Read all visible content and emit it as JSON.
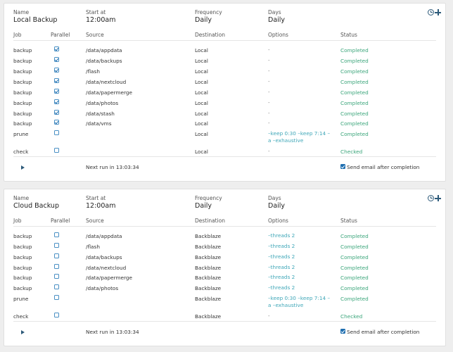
{
  "labels": {
    "name": "Name",
    "start_at": "Start at",
    "frequency": "Frequency",
    "days": "Days",
    "col_job": "Job",
    "col_parallel": "Parallel",
    "col_source": "Source",
    "col_destination": "Destination",
    "col_options": "Options",
    "col_status": "Status",
    "email": "Send email after completion"
  },
  "icons": {
    "schedule": "clock-icon",
    "add": "plus-icon",
    "run": "play-icon",
    "checkbox": "checkbox-icon"
  },
  "colors": {
    "status_green": "#3aa57a",
    "option_teal": "#3fa7b8",
    "icon_navy": "#2e5b7a",
    "checkbox_blue": "#1f6fb0"
  },
  "cards": [
    {
      "name": "Local Backup",
      "start_at": "12:00am",
      "frequency": "Daily",
      "days": "Daily",
      "next_run": "Next run in 13:03:34",
      "email_checked": true,
      "rows": [
        {
          "job": "backup",
          "parallel": true,
          "source": "/data/appdata",
          "destination": "Local",
          "options": "-",
          "status": "Completed"
        },
        {
          "job": "backup",
          "parallel": true,
          "source": "/data/backups",
          "destination": "Local",
          "options": "-",
          "status": "Completed"
        },
        {
          "job": "backup",
          "parallel": true,
          "source": "/flash",
          "destination": "Local",
          "options": "-",
          "status": "Completed"
        },
        {
          "job": "backup",
          "parallel": true,
          "source": "/data/nextcloud",
          "destination": "Local",
          "options": "-",
          "status": "Completed"
        },
        {
          "job": "backup",
          "parallel": true,
          "source": "/data/papermerge",
          "destination": "Local",
          "options": "-",
          "status": "Completed"
        },
        {
          "job": "backup",
          "parallel": true,
          "source": "/data/photos",
          "destination": "Local",
          "options": "-",
          "status": "Completed"
        },
        {
          "job": "backup",
          "parallel": true,
          "source": "/data/stash",
          "destination": "Local",
          "options": "-",
          "status": "Completed"
        },
        {
          "job": "backup",
          "parallel": true,
          "source": "/data/vms",
          "destination": "Local",
          "options": "-",
          "status": "Completed"
        },
        {
          "job": "prune",
          "parallel": false,
          "source": "",
          "destination": "Local",
          "options": "–keep 0:30 –keep 7:14 –a –exhaustive",
          "status": "Completed"
        },
        {
          "job": "check",
          "parallel": false,
          "source": "",
          "destination": "Local",
          "options": "-",
          "status": "Checked"
        }
      ]
    },
    {
      "name": "Cloud Backup",
      "start_at": "12:00am",
      "frequency": "Daily",
      "days": "Daily",
      "next_run": "Next run in 13:03:34",
      "email_checked": true,
      "rows": [
        {
          "job": "backup",
          "parallel": false,
          "source": "/data/appdata",
          "destination": "Backblaze",
          "options": "–threads 2",
          "status": "Completed"
        },
        {
          "job": "backup",
          "parallel": false,
          "source": "/flash",
          "destination": "Backblaze",
          "options": "–threads 2",
          "status": "Completed"
        },
        {
          "job": "backup",
          "parallel": false,
          "source": "/data/backups",
          "destination": "Backblaze",
          "options": "–threads 2",
          "status": "Completed"
        },
        {
          "job": "backup",
          "parallel": false,
          "source": "/data/nextcloud",
          "destination": "Backblaze",
          "options": "–threads 2",
          "status": "Completed"
        },
        {
          "job": "backup",
          "parallel": false,
          "source": "/data/papermerge",
          "destination": "Backblaze",
          "options": "–threads 2",
          "status": "Completed"
        },
        {
          "job": "backup",
          "parallel": false,
          "source": "/data/photos",
          "destination": "Backblaze",
          "options": "–threads 2",
          "status": "Completed"
        },
        {
          "job": "prune",
          "parallel": false,
          "source": "",
          "destination": "Backblaze",
          "options": "–keep 0:30 –keep 7:14 –a –exhaustive",
          "status": "Completed"
        },
        {
          "job": "check",
          "parallel": false,
          "source": "",
          "destination": "Backblaze",
          "options": "-",
          "status": "Checked"
        }
      ]
    }
  ]
}
